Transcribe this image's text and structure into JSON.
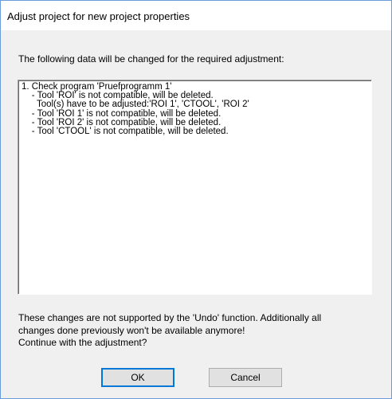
{
  "window": {
    "title": "Adjust project for new project properties"
  },
  "dialog": {
    "instruction": "The following data will be changed for the required adjustment:",
    "changes": [
      "1. Check program 'Pruefprogramm 1'",
      "    - Tool 'ROI' is not compatible, will be deleted.",
      "      Tool(s) have to be adjusted:'ROI 1', 'CTOOL', 'ROI 2'",
      "    - Tool 'ROI 1' is not compatible, will be deleted.",
      "    - Tool 'ROI 2' is not compatible, will be deleted.",
      "    - Tool 'CTOOL' is not compatible, will be deleted."
    ],
    "warning_lines": [
      "These changes are not supported by the 'Undo' function. Additionally all",
      "changes done previously won't be available anymore!",
      "Continue with the adjustment?"
    ]
  },
  "buttons": {
    "ok_label": "OK",
    "cancel_label": "Cancel"
  },
  "colors": {
    "window_border": "#6b9bd8",
    "dialog_background": "#f0f0f0",
    "default_button_border": "#0078d7"
  }
}
